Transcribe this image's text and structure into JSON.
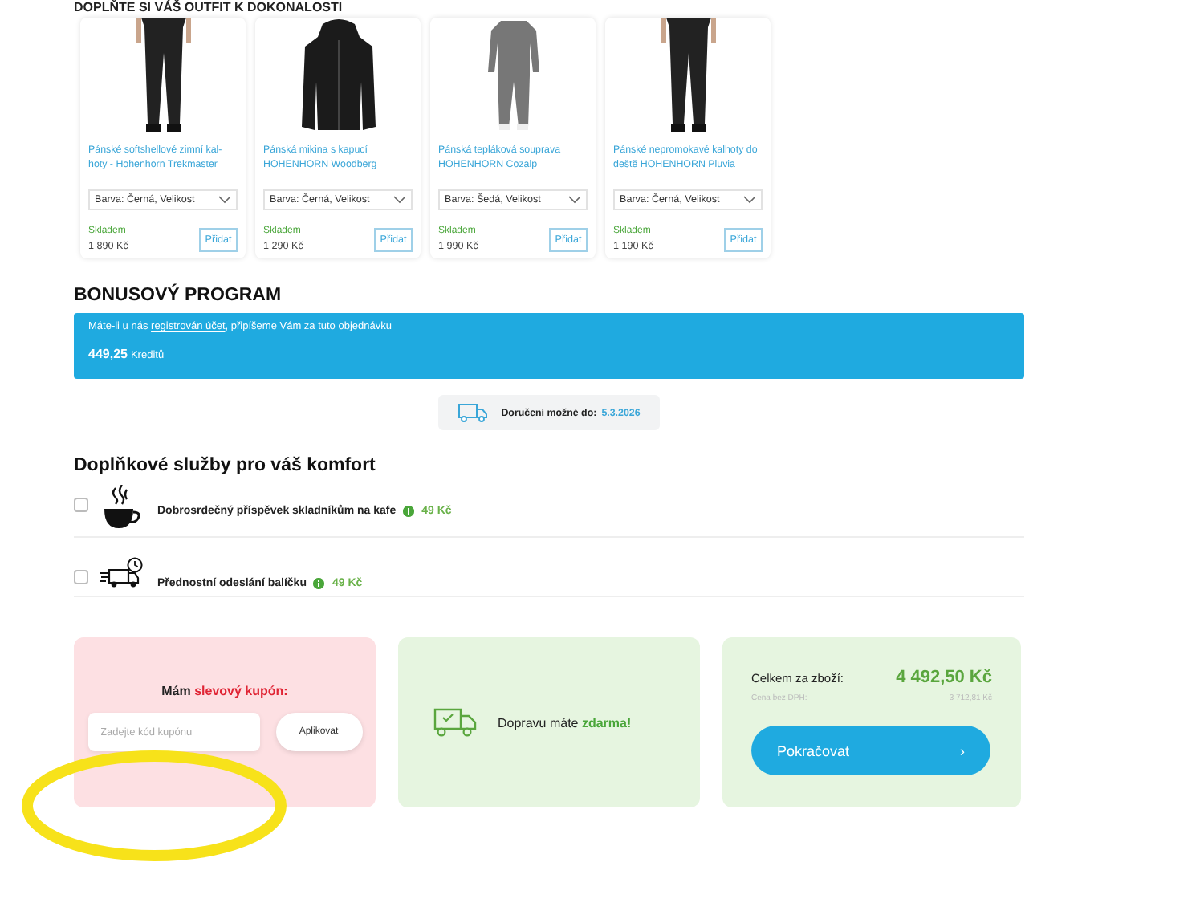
{
  "outfit": {
    "heading": "DOPLŇTE SI VÁŠ OUTFIT K DOKONALOSTI",
    "products": [
      {
        "name": "Pánské softshellové zimní kal-hoty - Hohenhorn Trekmaster",
        "variant": "Barva: Černá, Velikost",
        "stock": "Skladem",
        "price": "1 890 Kč",
        "button": "Přidat",
        "kind": "pants"
      },
      {
        "name": "Pánská mikina s kapucí HOHENHORN Woodberg",
        "variant": "Barva: Černá, Velikost",
        "stock": "Skladem",
        "price": "1 290 Kč",
        "button": "Přidat",
        "kind": "hoodie"
      },
      {
        "name": "Pánská tepláková souprava HOHENHORN Cozalp",
        "variant": "Barva: Šedá, Velikost",
        "stock": "Skladem",
        "price": "1 990 Kč",
        "button": "Přidat",
        "kind": "tracksuit"
      },
      {
        "name": "Pánské nepromokavé kalhoty do deště HOHENHORN Pluvia",
        "variant": "Barva: Černá, Velikost",
        "stock": "Skladem",
        "price": "1 190 Kč",
        "button": "Přidat",
        "kind": "pants"
      }
    ]
  },
  "bonus": {
    "heading": "BONUSOVÝ PROGRAM",
    "text_before": "Máte-li u nás ",
    "link": "registrován účet",
    "text_after": ", připíšeme Vám za tuto objednávku",
    "amount": "449,25",
    "unit": "Kreditů"
  },
  "delivery": {
    "label": "Doručení možné do:",
    "date": "5.3.2026"
  },
  "services": {
    "heading": "Doplňkové služby pro váš komfort",
    "items": [
      {
        "kind": "coffee",
        "label": "Dobrosrdečný příspěvek skladníkům na kafe",
        "price": "49 Kč",
        "checked": false
      },
      {
        "kind": "express",
        "label": "Přednostní odeslání balíčku",
        "price": "49 Kč",
        "checked": false
      }
    ]
  },
  "coupon": {
    "title": "Mám ",
    "title_highlight": "slevový kupón:",
    "placeholder": "Zadejte kód kupónu",
    "button": "Aplikovat"
  },
  "shipping": {
    "text": "Dopravu máte ",
    "highlight": "zdarma!"
  },
  "summary": {
    "total_label": "Celkem za zboží:",
    "total": "4 492,50 Kč",
    "net_label": "Cena bez DPH:",
    "net": "3 712,81 Kč",
    "button": "Pokračovat",
    "button_icon": "›"
  }
}
